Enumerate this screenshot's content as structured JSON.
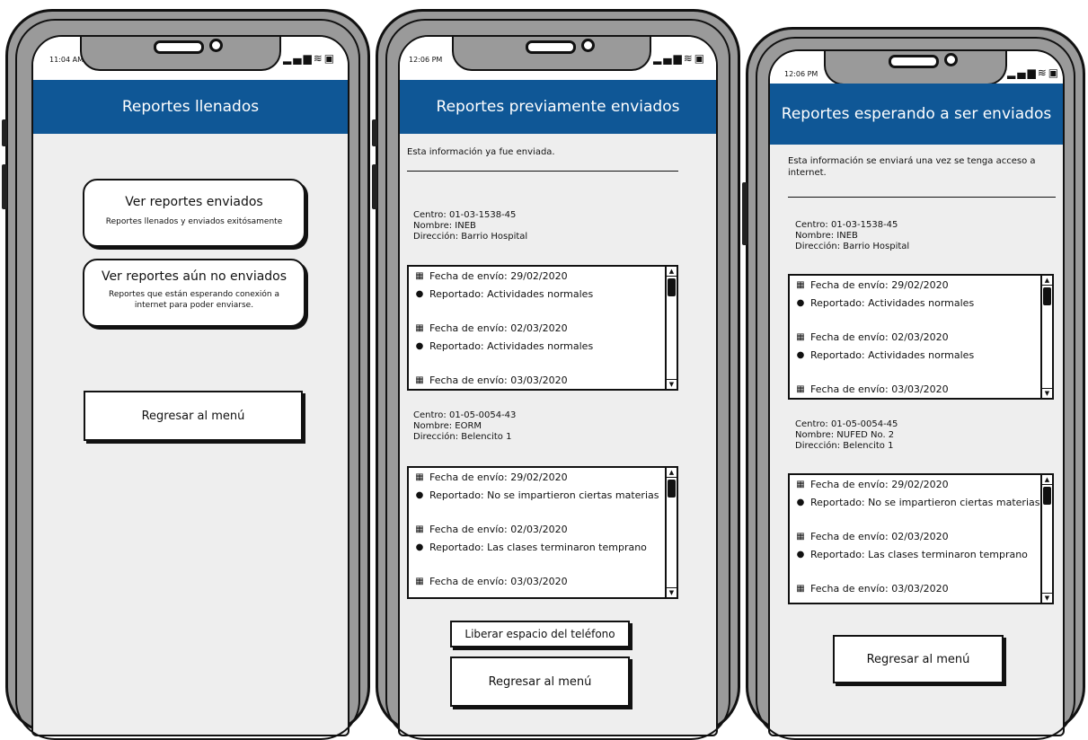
{
  "screens": [
    {
      "time": "11:04 AM",
      "title": "Reportes llenados",
      "cards": [
        {
          "title": "Ver reportes enviados",
          "subtitle": "Reportes llenados y enviados exitósamente"
        },
        {
          "title": "Ver reportes aún no enviados",
          "subtitle": "Reportes que están esperando conexión a internet para poder enviarse."
        }
      ],
      "back_button": "Regresar al menú"
    },
    {
      "time": "12:06 PM",
      "title": "Reportes previamente enviados",
      "intro": "Esta información ya fue enviada.",
      "centers": [
        {
          "lines": [
            "Centro: 01-03-1538-45",
            "Nombre: INEB",
            "Dirección: Barrio Hospital"
          ],
          "entries": [
            {
              "icon": "calendar-icon",
              "text": "Fecha de envío: 29/02/2020"
            },
            {
              "icon": "comment-icon",
              "text": "Reportado: Actividades normales"
            },
            {
              "icon": "calendar-icon",
              "text": "Fecha de envío: 02/03/2020"
            },
            {
              "icon": "comment-icon",
              "text": "Reportado: Actividades normales"
            },
            {
              "icon": "calendar-icon",
              "text": "Fecha de envío: 03/03/2020"
            }
          ]
        },
        {
          "lines": [
            "Centro: 01-05-0054-43",
            "Nombre: EORM",
            "Dirección: Belencito 1"
          ],
          "entries": [
            {
              "icon": "calendar-icon",
              "text": "Fecha de envío: 29/02/2020"
            },
            {
              "icon": "comment-icon",
              "text": "Reportado: No se impartieron ciertas materias"
            },
            {
              "icon": "calendar-icon",
              "text": "Fecha de envío: 02/03/2020"
            },
            {
              "icon": "comment-icon",
              "text": "Reportado: Las clases terminaron temprano"
            },
            {
              "icon": "calendar-icon",
              "text": "Fecha de envío: 03/03/2020"
            }
          ]
        }
      ],
      "free_space_button": "Liberar espacio del teléfono",
      "back_button": "Regresar al menú"
    },
    {
      "time": "12:06 PM",
      "title": "Reportes esperando a ser enviados",
      "intro": "Esta información se enviará una vez se tenga acceso a internet.",
      "centers": [
        {
          "lines": [
            "Centro: 01-03-1538-45",
            "Nombre: INEB",
            "Dirección: Barrio Hospital"
          ],
          "entries": [
            {
              "icon": "calendar-icon",
              "text": "Fecha de envío: 29/02/2020"
            },
            {
              "icon": "comment-icon",
              "text": "Reportado: Actividades normales"
            },
            {
              "icon": "calendar-icon",
              "text": "Fecha de envío: 02/03/2020"
            },
            {
              "icon": "comment-icon",
              "text": "Reportado: Actividades normales"
            },
            {
              "icon": "calendar-icon",
              "text": "Fecha de envío: 03/03/2020"
            }
          ]
        },
        {
          "lines": [
            "Centro: 01-05-0054-45",
            "Nombre: NUFED No. 2",
            "Dirección: Belencito 1"
          ],
          "entries": [
            {
              "icon": "calendar-icon",
              "text": "Fecha de envío: 29/02/2020"
            },
            {
              "icon": "comment-icon",
              "text": "Reportado: No se impartieron ciertas materias"
            },
            {
              "icon": "calendar-icon",
              "text": "Fecha de envío: 02/03/2020"
            },
            {
              "icon": "comment-icon",
              "text": "Reportado: Las clases terminaron temprano"
            },
            {
              "icon": "calendar-icon",
              "text": "Fecha de envío: 03/03/2020"
            }
          ]
        }
      ],
      "back_button": "Regresar al menú"
    }
  ],
  "colors": {
    "header": "#0f5796",
    "screen_bg": "#eeeeee",
    "phone_frame": "#9a9a9a"
  },
  "icons": {
    "signal": "signal-icon",
    "wifi": "wifi-icon",
    "battery": "battery-icon",
    "speaker": "speaker-icon",
    "camera": "camera-icon"
  }
}
